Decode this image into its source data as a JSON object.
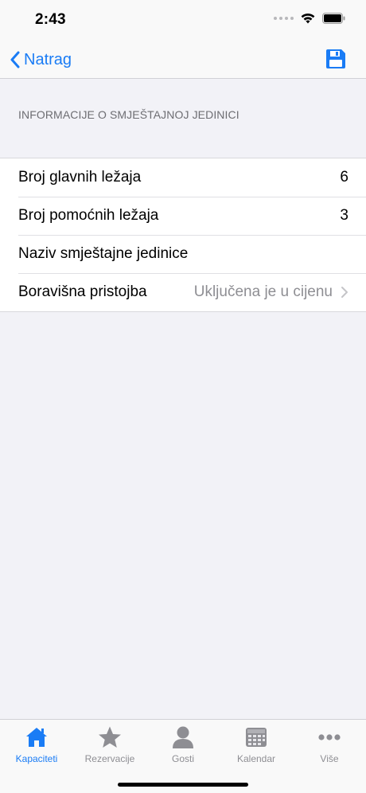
{
  "status_bar": {
    "time": "2:43"
  },
  "nav": {
    "back_label": "Natrag"
  },
  "section": {
    "header": "INFORMACIJE O SMJEŠTAJNOJ JEDINICI"
  },
  "rows": [
    {
      "label": "Broj glavnih ležaja",
      "value": "6"
    },
    {
      "label": "Broj pomoćnih ležaja",
      "value": "3"
    },
    {
      "label": "Naziv smještajne jedinice",
      "value": ""
    },
    {
      "label": "Boravišna pristojba",
      "value": "Uključena je u cijenu"
    }
  ],
  "tabs": [
    {
      "label": "Kapaciteti",
      "icon": "house-icon",
      "active": true
    },
    {
      "label": "Rezervacije",
      "icon": "star-icon",
      "active": false
    },
    {
      "label": "Gosti",
      "icon": "person-icon",
      "active": false
    },
    {
      "label": "Kalendar",
      "icon": "calendar-icon",
      "active": false
    },
    {
      "label": "Više",
      "icon": "more-icon",
      "active": false
    }
  ],
  "colors": {
    "accent": "#1a7cf5",
    "inactive": "#8e8e93",
    "background": "#f2f2f7"
  }
}
